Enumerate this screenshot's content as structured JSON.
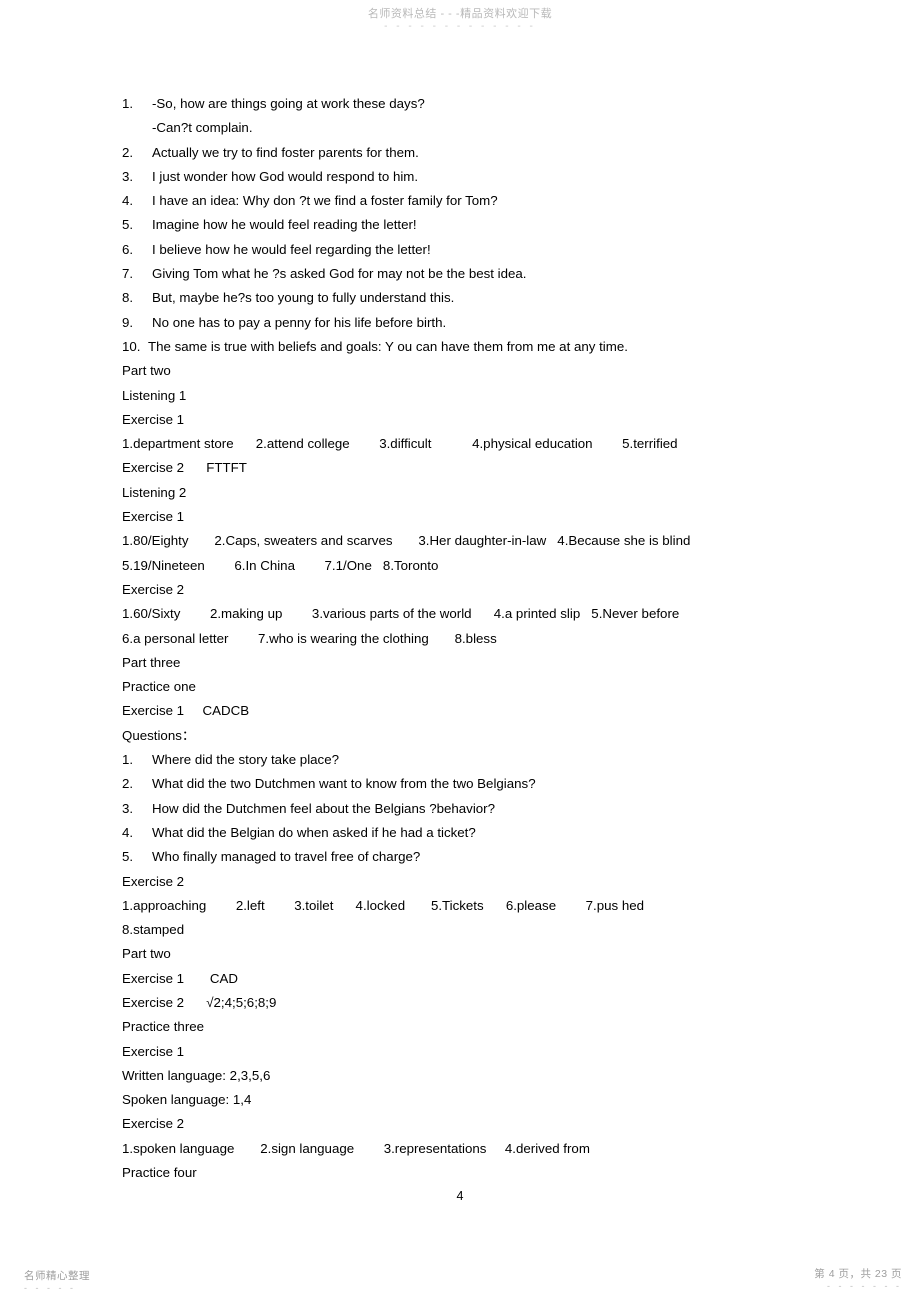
{
  "watermark": {
    "header_text": "名师资料总结 - - -精品资料欢迎下载",
    "header_dashes": "- - - - - - - - - - - - -",
    "footer_left_text": "名师精心整理",
    "footer_left_dashes": "- - - - -",
    "footer_right_text": "第 4 页，共 23 页",
    "footer_right_dashes": "- - - - - - -"
  },
  "page_number": "4",
  "sentences": [
    {
      "num": "1.",
      "text": "-So, how are things going at work these days?",
      "continuation": "-Can?t complain."
    },
    {
      "num": "2.",
      "text": "Actually we try to find foster parents for them."
    },
    {
      "num": "3.",
      "text": "I just wonder how God would respond to him."
    },
    {
      "num": "4.",
      "text": "I have an idea: Why don ?t we find a foster family for Tom?"
    },
    {
      "num": "5.",
      "text": "Imagine how he would feel reading the letter!"
    },
    {
      "num": "6.",
      "text": "I believe how he would feel regarding the letter!"
    },
    {
      "num": "7.",
      "text": "Giving Tom what he ?s asked God for may not be the best idea."
    },
    {
      "num": "8.",
      "text": "But, maybe he?s too young to fully understand this."
    },
    {
      "num": "9.",
      "text": "No one has to pay a penny for his life before birth."
    },
    {
      "num": "10.",
      "text": "The same is true with beliefs and goals: Y ou can have them from me at any time."
    }
  ],
  "body_lines": [
    "Part two",
    "Listening 1",
    "Exercise 1",
    "1.department store      2.attend college        3.difficult           4.physical education        5.terrified",
    "Exercise 2      FTTFT",
    "Listening 2",
    "Exercise 1",
    "1.80/Eighty       2.Caps, sweaters and scarves       3.Her daughter-in-law   4.Because she is blind",
    "5.19/Nineteen        6.In China        7.1/One   8.Toronto",
    "Exercise 2",
    "1.60/Sixty        2.making up        3.various parts of the world      4.a printed slip   5.Never before",
    "6.a personal letter        7.who is wearing the clothing       8.bless",
    "Part three",
    "Practice one",
    "Exercise 1     CADCB",
    "Questions："
  ],
  "questions": [
    {
      "num": "1.",
      "text": "Where did the story take place?"
    },
    {
      "num": "2.",
      "text": "What did the two Dutchmen want to know from the two Belgians?"
    },
    {
      "num": "3.",
      "text": "How did the Dutchmen feel about the Belgians ?behavior?"
    },
    {
      "num": "4.",
      "text": "What did the Belgian do when asked if he had a ticket?"
    },
    {
      "num": "5.",
      "text": "Who finally managed to travel free of charge?"
    }
  ],
  "body_lines_2": [
    "Exercise 2",
    "1.approaching        2.left        3.toilet      4.locked       5.Tickets      6.please        7.pus hed",
    "8.stamped",
    "Part two",
    "Exercise 1       CAD",
    "Exercise 2      √2;4;5;6;8;9",
    "Practice three",
    "Exercise 1",
    "Written language: 2,3,5,6",
    "Spoken language: 1,4",
    "Exercise 2",
    "1.spoken language       2.sign language        3.representations     4.derived from",
    "Practice four"
  ]
}
